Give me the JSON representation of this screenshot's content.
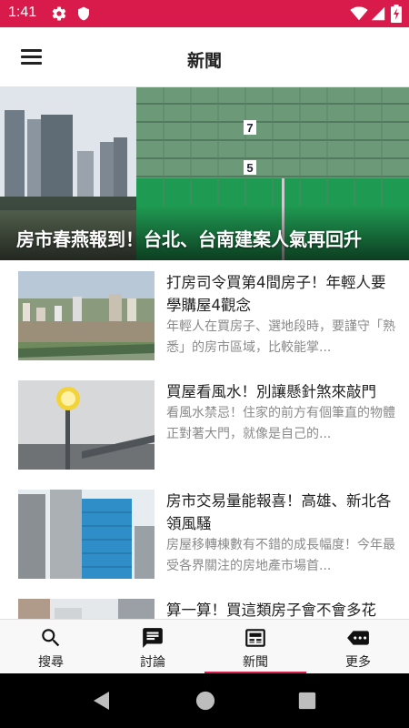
{
  "status_bar": {
    "time": "1:41",
    "icons": [
      "gear-icon",
      "shield-icon",
      "wifi-icon",
      "signal-icon",
      "battery-charging-icon"
    ],
    "background_color": "#d81b4a"
  },
  "app_bar": {
    "title": "新聞",
    "menu_icon": "hamburger-menu-icon"
  },
  "hero": {
    "caption": "房市春燕報到！台北、台南建案人氣再回升",
    "image_description_icon": "building-construction-photo"
  },
  "news": [
    {
      "title": "打房司令買第4間房子！年輕人要學購屋4觀念",
      "summary": "年輕人在買房子、選地段時，要謹守「熟悉」的房市區域，比較能掌..."
    },
    {
      "title": "買屋看風水！別讓懸針煞來敲門",
      "summary": "看風水禁忌！住家的前方有個筆直的物體正對著大門，就像是自己的..."
    },
    {
      "title": "房市交易量能報喜！高雄、新北各領風騷",
      "summary": "房屋移轉棟數有不錯的成長幅度！今年最受各界關注的房地產市場首..."
    },
    {
      "title": "算一算！買這類房子會不會多花",
      "summary": ""
    }
  ],
  "bottom_nav": {
    "items": [
      {
        "label": "搜尋",
        "icon": "search-icon"
      },
      {
        "label": "討論",
        "icon": "chat-icon"
      },
      {
        "label": "新聞",
        "icon": "news-icon"
      },
      {
        "label": "更多",
        "icon": "more-icon"
      }
    ],
    "active_index": 2,
    "accent_color": "#d81b4a"
  },
  "system_nav": {
    "icons": [
      "back-icon",
      "home-icon",
      "recents-icon"
    ]
  }
}
